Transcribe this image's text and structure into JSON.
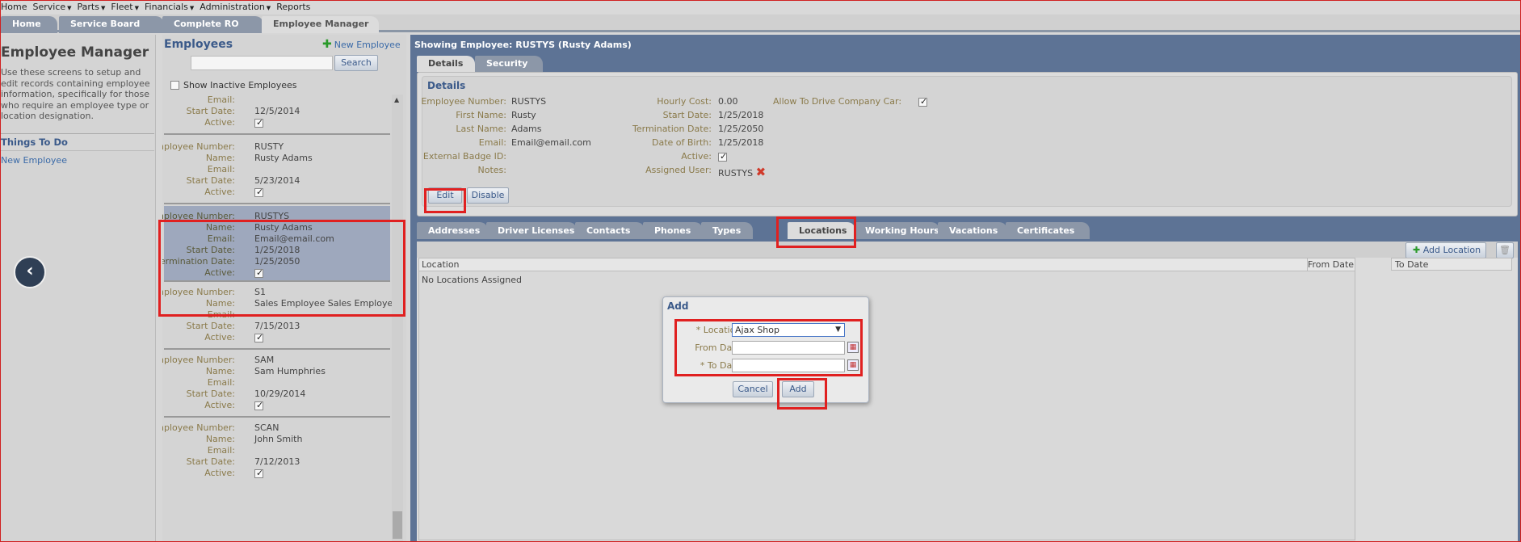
{
  "menu": [
    {
      "label": "Home",
      "caret": false
    },
    {
      "label": "Service",
      "caret": true
    },
    {
      "label": "Parts",
      "caret": true
    },
    {
      "label": "Fleet",
      "caret": true
    },
    {
      "label": "Financials",
      "caret": true
    },
    {
      "label": "Administration",
      "caret": true
    },
    {
      "label": "Reports",
      "caret": false
    }
  ],
  "tabs": {
    "home": "Home",
    "service_board": "Service Board",
    "complete_ro": "Complete RO",
    "employee_manager": "Employee Manager"
  },
  "sidebar": {
    "title": "Employee Manager",
    "description": "Use these screens to setup and edit records containing employee information, specifically for those who require an employee type or location designation.",
    "todo_title": "Things To Do",
    "todo_link": "New Employee",
    "back_icon": "chevron-left-icon"
  },
  "employees": {
    "title": "Employees",
    "new_label": "New Employee",
    "search_label": "Search",
    "search_value": "",
    "show_inactive_label": "Show Inactive Employees",
    "labels": {
      "number": "Employee Number:",
      "name": "Name:",
      "email": "Email:",
      "start": "Start Date:",
      "term": "Termination Date:",
      "active": "Active:"
    },
    "partial": {
      "start": "12/5/2014"
    },
    "cards": [
      {
        "number": "RUSTY",
        "name": "Rusty Adams",
        "email": "",
        "start": "5/23/2014"
      },
      {
        "number": "RUSTYS",
        "name": "Rusty Adams",
        "email": "Email@email.com",
        "start": "1/25/2018",
        "term": "1/25/2050"
      },
      {
        "number": "S1",
        "name": "Sales Employee Sales Employee",
        "email": "",
        "start": "7/15/2013"
      },
      {
        "number": "SAM",
        "name": "Sam Humphries",
        "email": "",
        "start": "10/29/2014"
      },
      {
        "number": "SCAN",
        "name": "John Smith",
        "email": "",
        "start": "7/12/2013"
      }
    ]
  },
  "main": {
    "showing": "Showing Employee: RUSTYS (Rusty Adams)",
    "tab_details": "Details",
    "tab_security": "Security",
    "section_title": "Details",
    "fields": {
      "employee_number_label": "Employee Number:",
      "employee_number": "RUSTYS",
      "first_name_label": "First Name:",
      "first_name": "Rusty",
      "last_name_label": "Last Name:",
      "last_name": "Adams",
      "email_label": "Email:",
      "email": "Email@email.com",
      "badge_label": "External Badge ID:",
      "badge": "",
      "notes_label": "Notes:",
      "notes": "",
      "hourly_cost_label": "Hourly Cost:",
      "hourly_cost": "0.00",
      "start_date_label": "Start Date:",
      "start_date": "1/25/2018",
      "term_date_label": "Termination Date:",
      "term_date": "1/25/2050",
      "dob_label": "Date of Birth:",
      "dob": "1/25/2018",
      "active_label": "Active:",
      "assigned_user_label": "Assigned User:",
      "assigned_user": "RUSTYS",
      "company_car_label": "Allow To Drive Company Car:"
    },
    "edit_label": "Edit",
    "disable_label": "Disable",
    "lower_tabs": [
      "Addresses",
      "Driver Licenses",
      "Contacts",
      "Phones",
      "Types",
      "Locations",
      "Working Hours",
      "Vacations",
      "Certificates"
    ],
    "add_location_label": "Add Location",
    "grid_headers": {
      "location": "Location",
      "from": "From Date",
      "to": "To Date"
    },
    "empty_message": "No Locations Assigned"
  },
  "dialog": {
    "title": "Add",
    "location_label": "* Location:",
    "location_value": "Ajax Shop",
    "from_label": "From Date:",
    "from_value": "",
    "to_label": "* To Date:",
    "to_value": "",
    "cancel_label": "Cancel",
    "add_label": "Add"
  },
  "colors": {
    "highlight": "#e02020",
    "panel_blue": "#5d7395",
    "link": "#3a6aa8"
  }
}
